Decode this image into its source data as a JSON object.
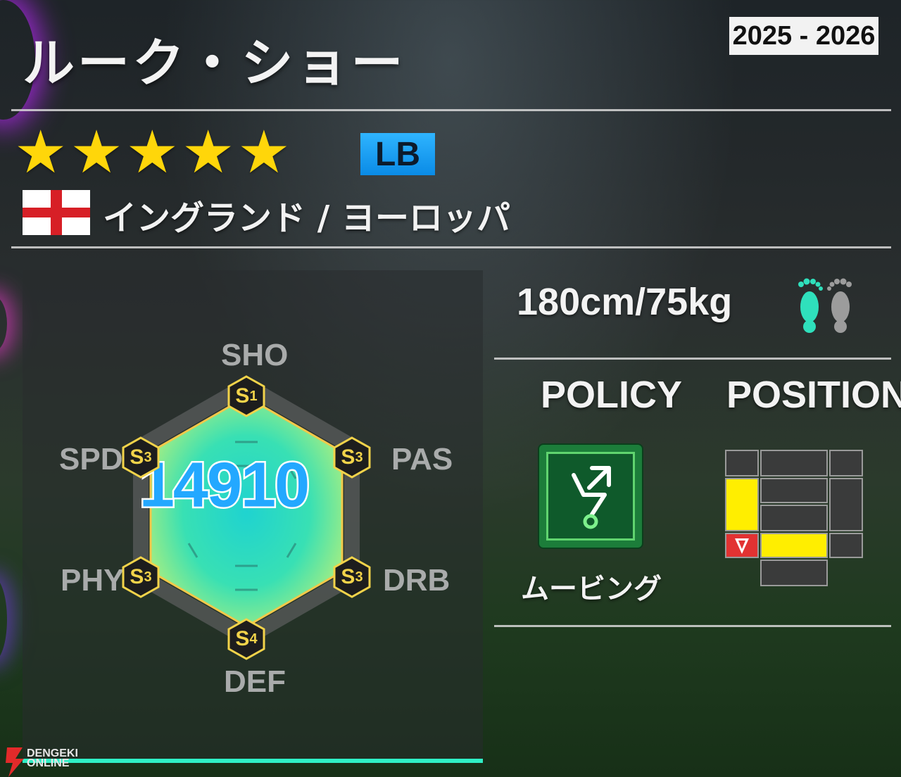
{
  "player": {
    "name": "ルーク・ショー",
    "season": "2025 - 2026",
    "rarity_stars": 5,
    "position": "LB",
    "nation": "イングランド / ヨーロッパ",
    "flag_icon": "england-flag-icon",
    "body": "180cm/75kg",
    "preferred_foot_icon": "feet-left-foot-icon"
  },
  "stats": {
    "total": "14910",
    "axes": [
      {
        "key": "SHO",
        "grade_letter": "S",
        "grade_num": "1"
      },
      {
        "key": "PAS",
        "grade_letter": "S",
        "grade_num": "3"
      },
      {
        "key": "DRB",
        "grade_letter": "S",
        "grade_num": "3"
      },
      {
        "key": "DEF",
        "grade_letter": "S",
        "grade_num": "4"
      },
      {
        "key": "PHY",
        "grade_letter": "S",
        "grade_num": "3"
      },
      {
        "key": "SPD",
        "grade_letter": "S",
        "grade_num": "3"
      }
    ]
  },
  "policy": {
    "header": "POLICY",
    "name": "ムービング",
    "icon": "moving-policy-icon"
  },
  "position_map": {
    "header": "POSITION",
    "highlight_color": "#ffee00",
    "current_color": "#e23232"
  },
  "watermark": {
    "line1": "DENGEKI",
    "line2": "ONLINE"
  },
  "colors": {
    "star": "#ffd60a",
    "accent_cyan": "#2ff0c6",
    "total_blue": "#23a8ff",
    "badge_blue": "#1aa6f5"
  }
}
